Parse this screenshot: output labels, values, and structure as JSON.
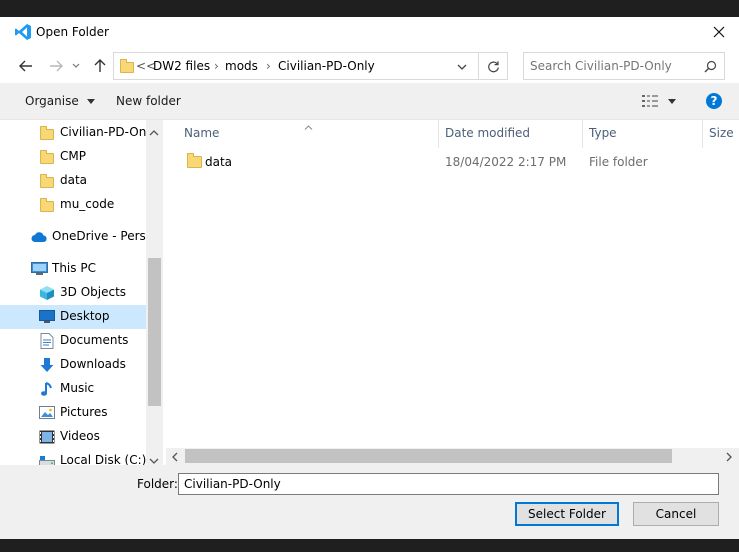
{
  "window": {
    "title": "Open Folder"
  },
  "address": {
    "overflow": "<<",
    "crumbs": [
      "DW2 files",
      "mods",
      "Civilian-PD-Only"
    ]
  },
  "search": {
    "placeholder": "Search Civilian-PD-Only"
  },
  "toolbar": {
    "organise": "Organise",
    "new_folder": "New folder"
  },
  "nav": {
    "items": [
      {
        "label": "Civilian-PD-Only",
        "icon": "folder-icon"
      },
      {
        "label": "CMP",
        "icon": "folder-icon"
      },
      {
        "label": "data",
        "icon": "folder-icon"
      },
      {
        "label": "mu_code",
        "icon": "folder-icon"
      },
      {
        "label": "OneDrive - Person",
        "icon": "cloud-icon"
      },
      {
        "label": "This PC",
        "icon": "computer-icon"
      },
      {
        "label": "3D Objects",
        "icon": "cube-icon"
      },
      {
        "label": "Desktop",
        "icon": "desktop-icon"
      },
      {
        "label": "Documents",
        "icon": "documents-icon"
      },
      {
        "label": "Downloads",
        "icon": "download-icon"
      },
      {
        "label": "Music",
        "icon": "music-icon"
      },
      {
        "label": "Pictures",
        "icon": "pictures-icon"
      },
      {
        "label": "Videos",
        "icon": "videos-icon"
      },
      {
        "label": "Local Disk (C:)",
        "icon": "disk-icon"
      }
    ]
  },
  "columns": {
    "name": "Name",
    "date": "Date modified",
    "type": "Type",
    "size": "Size"
  },
  "files": [
    {
      "name": "data",
      "date": "18/04/2022 2:17 PM",
      "type": "File folder"
    }
  ],
  "footer": {
    "folder_label": "Folder:",
    "folder_value": "Civilian-PD-Only",
    "select_button": "Select Folder",
    "cancel_button": "Cancel"
  },
  "colors": {
    "accent": "#0078d7",
    "selection": "#cce8ff",
    "folder": "#f8d775"
  }
}
